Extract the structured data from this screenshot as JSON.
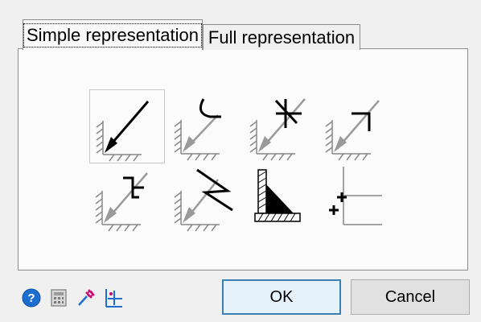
{
  "tabs": [
    {
      "label": "Simple representation",
      "selected": true
    },
    {
      "label": "Full representation",
      "selected": false
    }
  ],
  "symbols": [
    {
      "name": "arrow-weld-icon",
      "selected": true
    },
    {
      "name": "arc-weld-icon"
    },
    {
      "name": "star-weld-icon"
    },
    {
      "name": "corner-weld-icon"
    },
    {
      "name": "stepped-weld-icon"
    },
    {
      "name": "zigzag-weld-icon"
    },
    {
      "name": "fillet-weld-icon"
    },
    {
      "name": "plus-grid-icon"
    }
  ],
  "toolbar": {
    "icons": [
      "help-icon",
      "calculator-icon",
      "pick-icon",
      "chart-icon"
    ],
    "help_accent": "#1c6fd1"
  },
  "buttons": {
    "ok_label": "OK",
    "cancel_label": "Cancel"
  }
}
